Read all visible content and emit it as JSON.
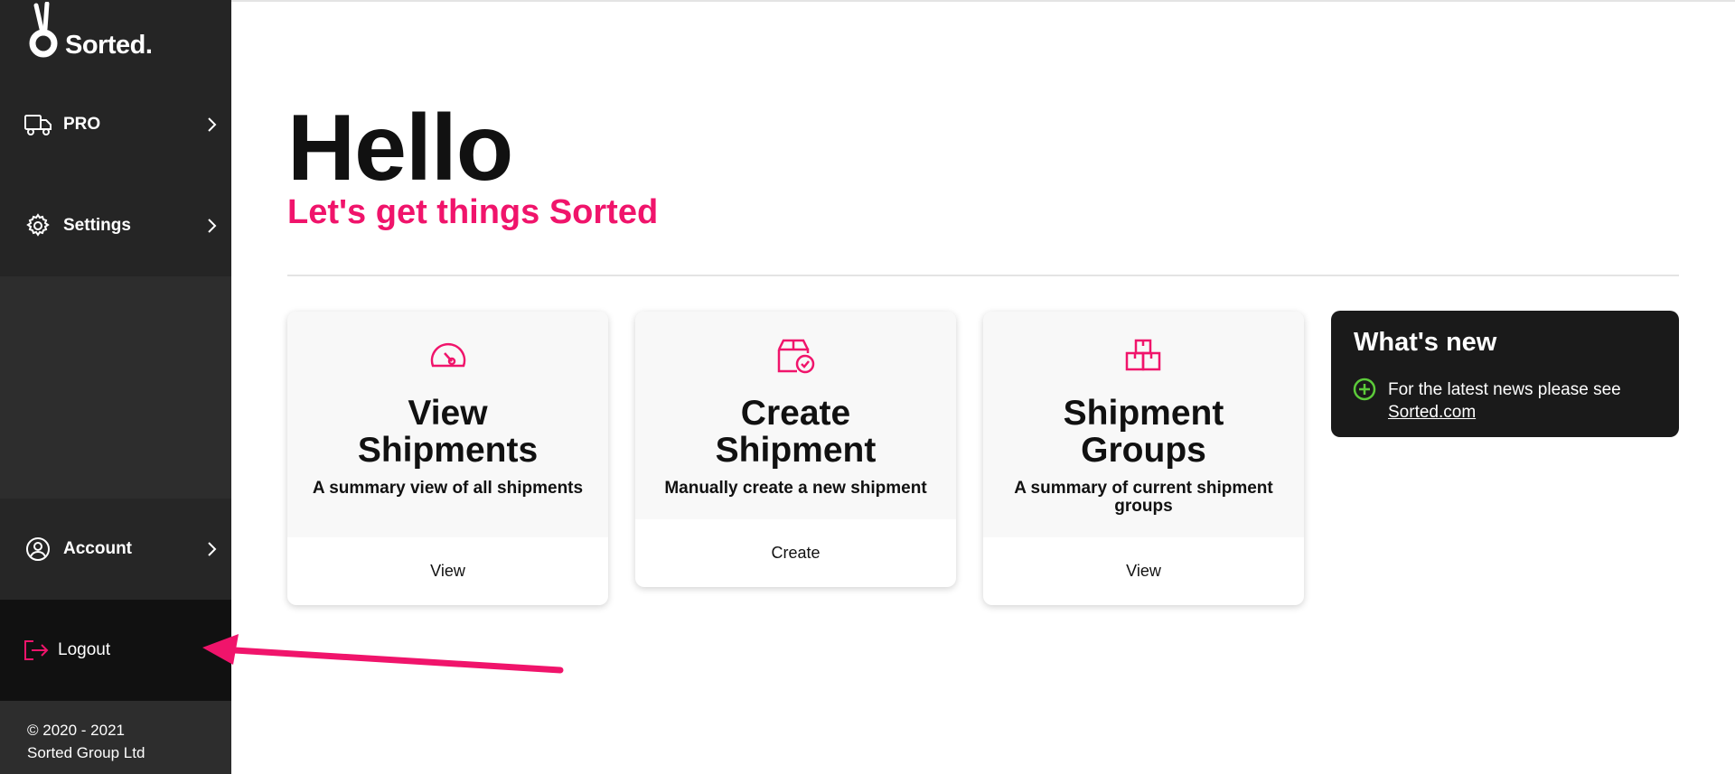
{
  "brand": {
    "name": "Sorted.",
    "accent_color": "#f0146b",
    "success_color": "#5ccb3a"
  },
  "sidebar": {
    "items": [
      {
        "label": "PRO",
        "icon": "truck-icon"
      },
      {
        "label": "Settings",
        "icon": "gear-icon"
      },
      {
        "label": "Account",
        "icon": "user-circle-icon"
      },
      {
        "label": "Logout",
        "icon": "logout-icon"
      }
    ],
    "copyright_line1": "© 2020 - 2021",
    "copyright_line2": "Sorted Group Ltd"
  },
  "main": {
    "greeting": "Hello",
    "subtitle": "Let's get things Sorted",
    "cards": [
      {
        "title_line1": "View",
        "title_line2": "Shipments",
        "description": "A summary view of all shipments",
        "action": "View",
        "icon": "speedometer-icon"
      },
      {
        "title_line1": "Create",
        "title_line2": "Shipment",
        "description": "Manually create a new shipment",
        "action": "Create",
        "icon": "box-check-icon"
      },
      {
        "title_line1": "Shipment",
        "title_line2": "Groups",
        "description": "A summary of current shipment groups",
        "action": "View",
        "icon": "boxes-icon"
      }
    ],
    "whats_new": {
      "title": "What's new",
      "text": "For the latest news please see",
      "link": "Sorted.com",
      "icon": "plus-circle-icon"
    }
  },
  "annotation": {
    "icon": "pointer-arrow-icon",
    "color": "#f0146b"
  }
}
